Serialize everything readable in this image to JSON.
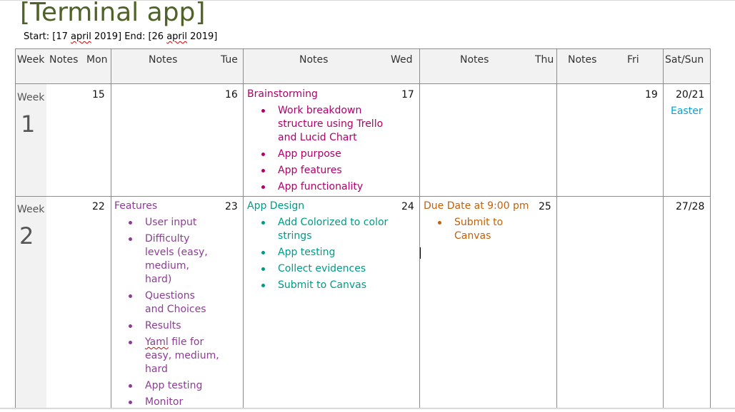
{
  "title": "[Terminal app]",
  "date_range": {
    "start_prefix": "Start: [17 ",
    "start_month": "april",
    "start_suffix": " 2019]",
    "end_prefix": " End: [26 ",
    "end_month": "april",
    "end_suffix": " 2019]"
  },
  "header": {
    "week": "Week",
    "notes1": "Notes",
    "mon": "Mon",
    "notes2": "Notes",
    "tue": "Tue",
    "notes3": "Notes",
    "wed": "Wed",
    "notes4": "Notes",
    "thu": "Thu",
    "notes5": "Notes",
    "fri": "Fri",
    "satsun": "Sat/Sun"
  },
  "week1": {
    "label": "Week",
    "number": "1",
    "mon": "15",
    "tue": "16",
    "wed": "17",
    "fri": "19",
    "satsun": "20/21",
    "easter": "Easter",
    "brainstorm": {
      "heading": "Brainstorming",
      "items": [
        "Work breakdown structure using Trello and Lucid Chart",
        "App purpose",
        "App features",
        "App functionality"
      ]
    }
  },
  "week2": {
    "label": "Week",
    "number": "2",
    "mon": "22",
    "tue": "23",
    "wed": "24",
    "thu": "25",
    "satsun": "27/28",
    "features": {
      "heading": "Features",
      "items": [
        "User input",
        "Difficulty levels (easy, medium, hard)",
        "Questions and Choices",
        "Results",
        "file for easy, medium, hard",
        "App testing",
        "Monitor"
      ],
      "yaml_word": "Yaml"
    },
    "app_design": {
      "heading": "App Design",
      "items": [
        "Add Colorized to color strings",
        "App testing",
        "Collect evidences",
        "Submit to Canvas"
      ]
    },
    "due": {
      "heading": "Due Date at 9:00 pm",
      "items": [
        "Submit to Canvas"
      ]
    }
  },
  "colors": {
    "title": "#4f6228",
    "brainstorm": "#b0006a",
    "features": "#8b3d93",
    "app_design": "#009a86",
    "due": "#c0620e",
    "easter": "#00a3d9"
  }
}
